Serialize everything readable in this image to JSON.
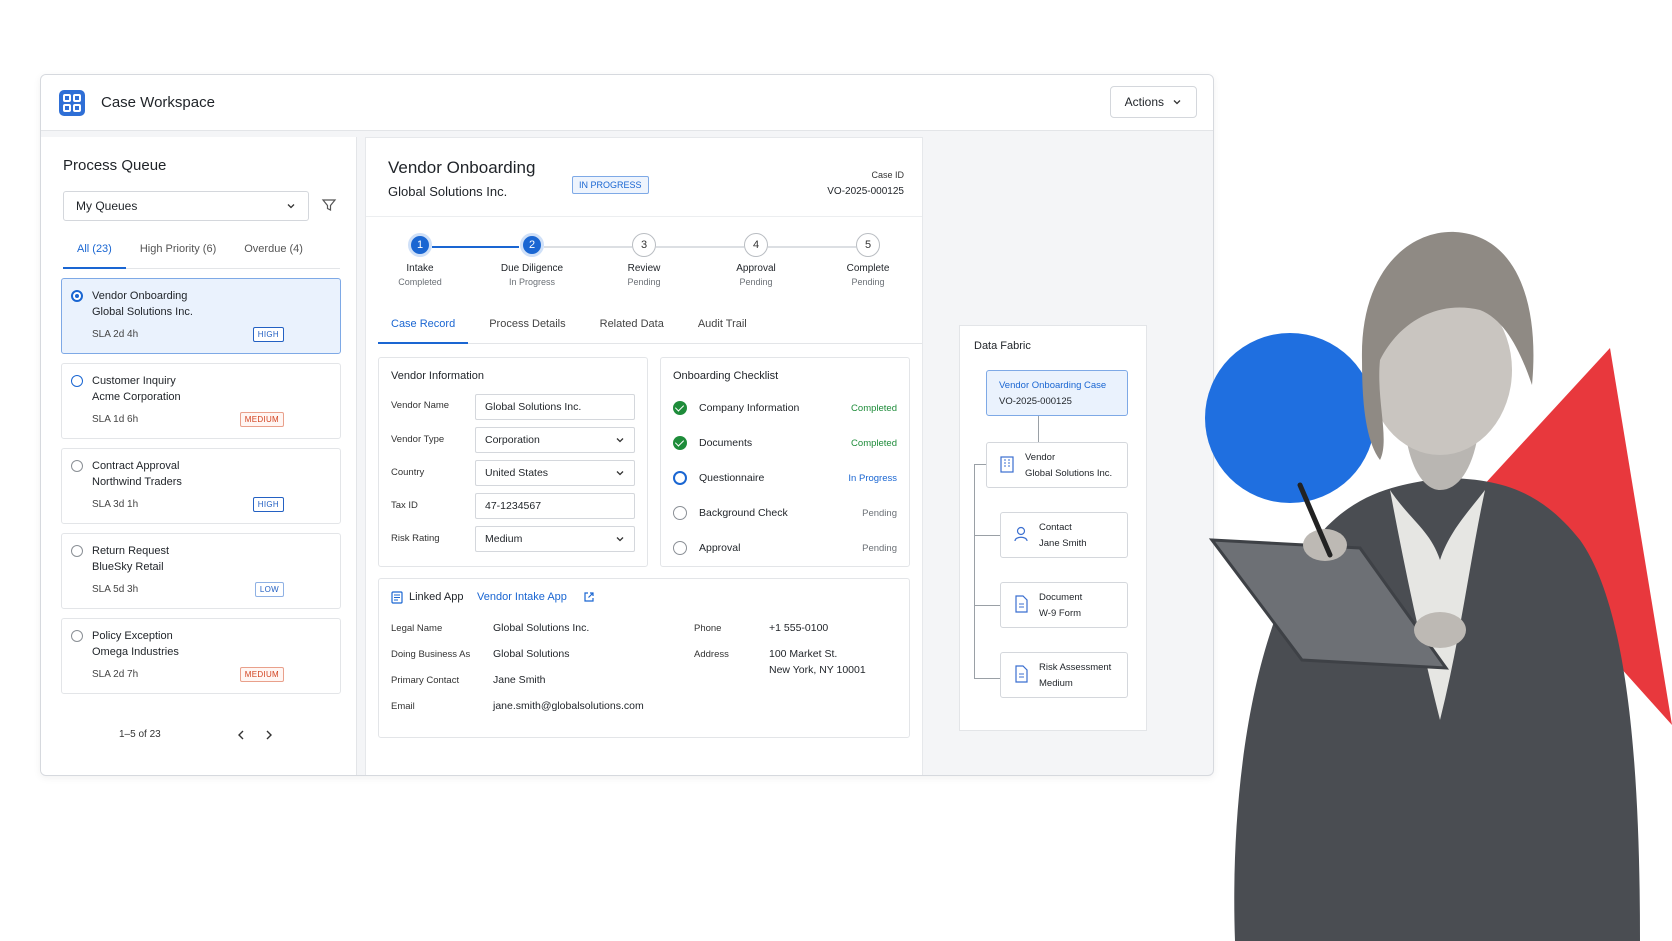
{
  "app": {
    "title": "Case Workspace",
    "actions_label": "Actions"
  },
  "queue": {
    "title": "Process Queue",
    "selector": "My Queues",
    "tabs": [
      "All (23)",
      "High Priority (6)",
      "Overdue (4)"
    ],
    "items": [
      {
        "title": "Vendor Onboarding",
        "subtitle": "Global Solutions Inc.",
        "sla": "SLA 2d 4h",
        "priority": "HIGH"
      },
      {
        "title": "Customer Inquiry",
        "subtitle": "Acme Corporation",
        "sla": "SLA 1d 6h",
        "priority": "MEDIUM"
      },
      {
        "title": "Contract Approval",
        "subtitle": "Northwind Traders",
        "sla": "SLA 3d 1h",
        "priority": "HIGH"
      },
      {
        "title": "Return Request",
        "subtitle": "BlueSky Retail",
        "sla": "SLA 5d 3h",
        "priority": "LOW"
      },
      {
        "title": "Policy Exception",
        "subtitle": "Omega Industries",
        "sla": "SLA 2d 7h",
        "priority": "MEDIUM"
      }
    ],
    "pager": "1–5 of 23"
  },
  "case": {
    "title": "Vendor Onboarding",
    "subtitle": "Global Solutions Inc.",
    "status": "IN PROGRESS",
    "case_id_label": "Case ID",
    "case_id": "VO-2025-000125",
    "steps": [
      {
        "num": "1",
        "name": "Intake",
        "state": "Completed"
      },
      {
        "num": "2",
        "name": "Due Diligence",
        "state": "In Progress"
      },
      {
        "num": "3",
        "name": "Review",
        "state": "Pending"
      },
      {
        "num": "4",
        "name": "Approval",
        "state": "Pending"
      },
      {
        "num": "5",
        "name": "Complete",
        "state": "Pending"
      }
    ],
    "tabs": [
      "Case Record",
      "Process Details",
      "Related Data",
      "Audit Trail"
    ],
    "vendor_info": {
      "title": "Vendor Information",
      "fields": [
        {
          "label": "Vendor Name",
          "value": "Global Solutions Inc."
        },
        {
          "label": "Vendor Type",
          "value": "Corporation"
        },
        {
          "label": "Country",
          "value": "United States"
        },
        {
          "label": "Tax ID",
          "value": "47-1234567"
        },
        {
          "label": "Risk Rating",
          "value": "Medium"
        }
      ]
    },
    "checklist": {
      "title": "Onboarding Checklist",
      "items": [
        {
          "name": "Company Information",
          "state": "Completed"
        },
        {
          "name": "Documents",
          "state": "Completed"
        },
        {
          "name": "Questionnaire",
          "state": "In Progress"
        },
        {
          "name": "Background Check",
          "state": "Pending"
        },
        {
          "name": "Approval",
          "state": "Pending"
        }
      ]
    },
    "linked_app": {
      "label": "Linked App",
      "app_name": "Vendor Intake App",
      "left": [
        {
          "label": "Legal Name",
          "value": "Global Solutions Inc."
        },
        {
          "label": "Doing Business As",
          "value": "Global Solutions"
        },
        {
          "label": "Primary Contact",
          "value": "Jane Smith"
        },
        {
          "label": "Email",
          "value": "jane.smith@globalsolutions.com"
        }
      ],
      "phone_label": "Phone",
      "phone": "+1 555-0100",
      "address_label": "Address",
      "address_line1": "100 Market St.",
      "address_line2": "New York, NY 10001"
    }
  },
  "fabric": {
    "title": "Data Fabric",
    "root": {
      "line1": "Vendor Onboarding Case",
      "line2": "VO-2025-000125"
    },
    "nodes": [
      {
        "line1": "Vendor",
        "line2": "Global Solutions Inc.",
        "icon": "building-icon"
      },
      {
        "line1": "Contact",
        "line2": "Jane Smith",
        "icon": "person-icon"
      },
      {
        "line1": "Document",
        "line2": "W-9 Form",
        "icon": "document-icon"
      },
      {
        "line1": "Risk Assessment",
        "line2": "Medium",
        "icon": "document-icon"
      }
    ]
  },
  "colors": {
    "accent": "#1a66d2",
    "success": "#1e8c3a",
    "warning": "#d2421f",
    "decor_blue": "#1f6fe0",
    "decor_red": "#e8383d"
  }
}
